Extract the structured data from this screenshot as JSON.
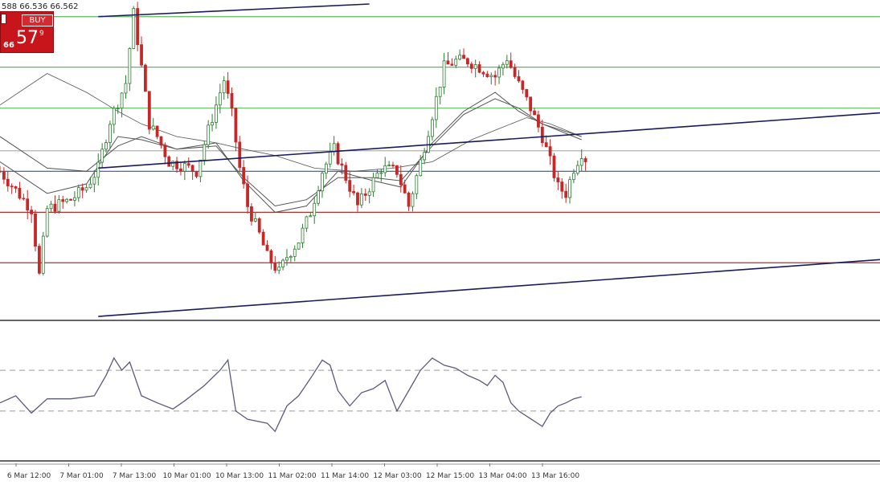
{
  "quote_bar": {
    "text": "588 66.536 66.562"
  },
  "trade_panel": {
    "buy_label": "BUY",
    "price_prefix": "66",
    "price_main": "57",
    "price_super": "9"
  },
  "chart_data": [
    {
      "type": "candlestick",
      "title": "",
      "x_ticks": [
        "6 Mar 12:00",
        "7 Mar 01:00",
        "7 Mar 13:00",
        "10 Mar 01:00",
        "10 Mar 13:00",
        "11 Mar 02:00",
        "11 Mar 14:00",
        "12 Mar 03:00",
        "12 Mar 15:00",
        "13 Mar 04:00",
        "13 Mar 16:00"
      ],
      "y_range": [
        0,
        100
      ],
      "grid": false,
      "colors": {
        "up": "#2e7d32",
        "down": "#c62828",
        "trendline": "#1a1a5e",
        "ma": "#555555"
      },
      "horizontal_levels": [
        {
          "value": 96,
          "color": "#5cb85c"
        },
        {
          "value": 80,
          "color": "#5cb85c"
        },
        {
          "value": 67,
          "color": "#5cb85c"
        },
        {
          "value": 53.5,
          "color": "#b0b0b0"
        },
        {
          "value": 47,
          "color": "#1f5f9e"
        },
        {
          "value": 34,
          "color": "#b03030"
        },
        {
          "value": 18,
          "color": "#b03030"
        }
      ],
      "trendlines": [
        {
          "from": [
            25,
            96
          ],
          "to": [
            94,
            100
          ]
        },
        {
          "from": [
            25,
            48
          ],
          "to": [
            224,
            65.5
          ]
        },
        {
          "from": [
            25,
            1
          ],
          "to": [
            224,
            19
          ]
        }
      ],
      "price_path": [
        [
          0,
          47
        ],
        [
          8,
          35
        ],
        [
          10,
          14
        ],
        [
          12,
          35
        ],
        [
          18,
          38
        ],
        [
          22,
          42
        ],
        [
          25,
          48
        ],
        [
          28,
          63
        ],
        [
          32,
          75
        ],
        [
          34,
          97
        ],
        [
          36,
          80
        ],
        [
          38,
          62
        ],
        [
          40,
          58
        ],
        [
          43,
          50
        ],
        [
          46,
          49
        ],
        [
          50,
          47
        ],
        [
          53,
          60
        ],
        [
          57,
          76
        ],
        [
          59,
          65
        ],
        [
          61,
          48
        ],
        [
          63,
          36
        ],
        [
          66,
          27
        ],
        [
          68,
          20
        ],
        [
          71,
          15
        ],
        [
          73,
          20
        ],
        [
          76,
          25
        ],
        [
          79,
          34
        ],
        [
          82,
          47
        ],
        [
          85,
          54
        ],
        [
          88,
          45
        ],
        [
          91,
          36
        ],
        [
          94,
          42
        ],
        [
          97,
          48
        ],
        [
          101,
          47
        ],
        [
          104,
          36
        ],
        [
          107,
          50
        ],
        [
          110,
          65
        ],
        [
          113,
          80
        ],
        [
          116,
          82
        ],
        [
          119,
          82
        ],
        [
          122,
          80
        ],
        [
          126,
          77
        ],
        [
          129,
          83
        ],
        [
          131,
          77
        ],
        [
          133,
          72
        ],
        [
          135,
          67
        ],
        [
          138,
          58
        ],
        [
          140,
          50
        ],
        [
          142,
          42
        ],
        [
          144,
          40
        ],
        [
          146,
          48
        ],
        [
          148,
          53
        ],
        [
          149,
          51
        ]
      ],
      "moving_averages": [
        {
          "name": "",
          "points": [
            [
              0,
              68
            ],
            [
              12,
              78
            ],
            [
              22,
              72
            ],
            [
              30,
              66
            ],
            [
              36,
              62
            ],
            [
              45,
              58
            ],
            [
              55,
              56
            ],
            [
              62,
              54
            ],
            [
              70,
              52
            ],
            [
              80,
              48
            ],
            [
              90,
              47
            ],
            [
              100,
              48
            ],
            [
              110,
              50
            ],
            [
              120,
              57
            ],
            [
              128,
              61
            ],
            [
              134,
              64
            ],
            [
              140,
              62
            ],
            [
              148,
              58
            ]
          ]
        },
        {
          "name": "",
          "points": [
            [
              0,
              58
            ],
            [
              12,
              48
            ],
            [
              22,
              47
            ],
            [
              30,
              55
            ],
            [
              36,
              58
            ],
            [
              45,
              54
            ],
            [
              55,
              55
            ],
            [
              62,
              45
            ],
            [
              70,
              36
            ],
            [
              78,
              38
            ],
            [
              86,
              45
            ],
            [
              95,
              45
            ],
            [
              102,
              44
            ],
            [
              110,
              55
            ],
            [
              118,
              65
            ],
            [
              126,
              70
            ],
            [
              132,
              67
            ],
            [
              138,
              62
            ],
            [
              148,
              57
            ]
          ]
        },
        {
          "name": "",
          "points": [
            [
              0,
              50
            ],
            [
              12,
              40
            ],
            [
              22,
              43
            ],
            [
              30,
              58
            ],
            [
              36,
              57
            ],
            [
              45,
              54
            ],
            [
              55,
              56
            ],
            [
              62,
              44
            ],
            [
              70,
              34
            ],
            [
              78,
              36
            ],
            [
              86,
              47
            ],
            [
              95,
              44
            ],
            [
              102,
              42
            ],
            [
              110,
              56
            ],
            [
              118,
              66
            ],
            [
              126,
              72
            ],
            [
              132,
              66
            ],
            [
              138,
              62
            ],
            [
              148,
              58
            ]
          ]
        }
      ]
    },
    {
      "type": "line",
      "title": "",
      "y_range": [
        0,
        100
      ],
      "levels": [
        70,
        30
      ],
      "series": [
        {
          "name": "",
          "points": [
            [
              0,
              38
            ],
            [
              4,
              45
            ],
            [
              8,
              28
            ],
            [
              12,
              42
            ],
            [
              18,
              42
            ],
            [
              24,
              45
            ],
            [
              27,
              65
            ],
            [
              29,
              82
            ],
            [
              31,
              70
            ],
            [
              33,
              78
            ],
            [
              36,
              45
            ],
            [
              40,
              38
            ],
            [
              44,
              32
            ],
            [
              47,
              40
            ],
            [
              52,
              55
            ],
            [
              56,
              70
            ],
            [
              58,
              80
            ],
            [
              60,
              30
            ],
            [
              63,
              22
            ],
            [
              68,
              18
            ],
            [
              70,
              10
            ],
            [
              73,
              35
            ],
            [
              76,
              45
            ],
            [
              79,
              62
            ],
            [
              82,
              80
            ],
            [
              84,
              75
            ],
            [
              86,
              50
            ],
            [
              89,
              35
            ],
            [
              92,
              48
            ],
            [
              95,
              52
            ],
            [
              98,
              60
            ],
            [
              101,
              30
            ],
            [
              104,
              50
            ],
            [
              107,
              70
            ],
            [
              110,
              82
            ],
            [
              113,
              75
            ],
            [
              116,
              72
            ],
            [
              119,
              65
            ],
            [
              122,
              60
            ],
            [
              124,
              55
            ],
            [
              126,
              65
            ],
            [
              128,
              58
            ],
            [
              130,
              38
            ],
            [
              132,
              30
            ],
            [
              134,
              25
            ],
            [
              136,
              20
            ],
            [
              138,
              15
            ],
            [
              140,
              28
            ],
            [
              142,
              35
            ],
            [
              144,
              38
            ],
            [
              146,
              42
            ],
            [
              148,
              44
            ]
          ]
        }
      ]
    }
  ]
}
